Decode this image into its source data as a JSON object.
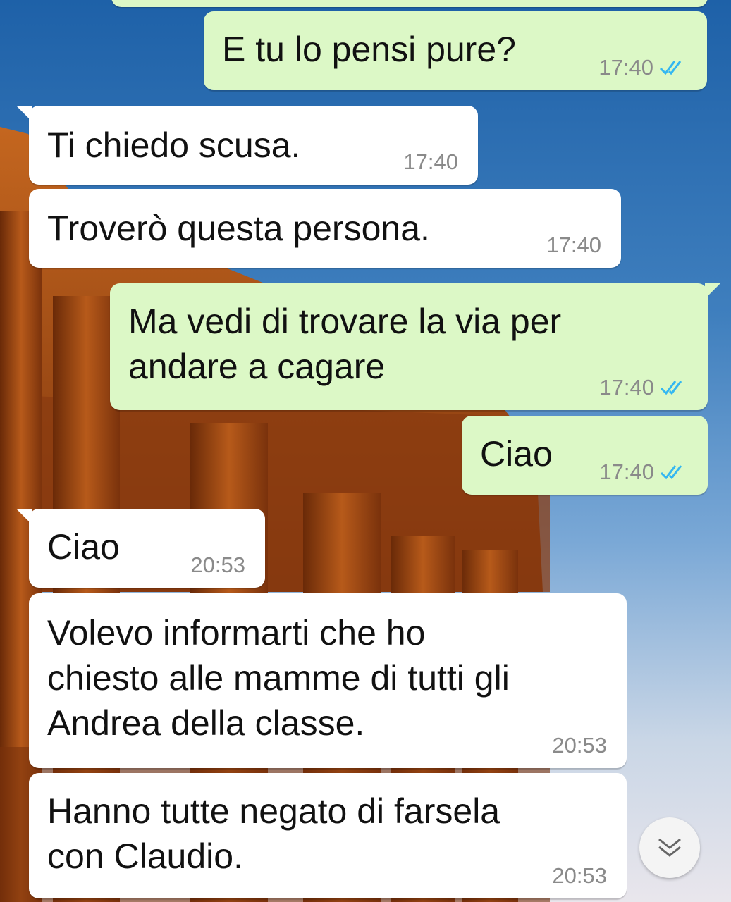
{
  "messages": [
    {
      "text": "",
      "time": "",
      "direction": "out"
    },
    {
      "text": "E tu lo pensi pure?",
      "time": "17:40",
      "direction": "out",
      "status": "read"
    },
    {
      "text": "Ti chiedo scusa.",
      "time": "17:40",
      "direction": "in"
    },
    {
      "text": "Troverò questa persona.",
      "time": "17:40",
      "direction": "in"
    },
    {
      "text": "Ma vedi di trovare la via per\nandare a cagare",
      "time": "17:40",
      "direction": "out",
      "status": "read"
    },
    {
      "text": "Ciao",
      "time": "17:40",
      "direction": "out",
      "status": "read"
    },
    {
      "text": "Ciao",
      "time": "20:53",
      "direction": "in"
    },
    {
      "text": "Volevo informarti che ho\nchiesto alle mamme di tutti gli\nAndrea della classe.",
      "time": "20:53",
      "direction": "in"
    },
    {
      "text": "Hanno tutte negato di farsela\ncon Claudio.",
      "time": "20:53",
      "direction": "in"
    }
  ],
  "scroll_button": {
    "icon": "chevron-double-down-icon"
  },
  "colors": {
    "outgoing_bubble": "#dcf8c6",
    "incoming_bubble": "#ffffff",
    "read_ticks": "#34b7f1",
    "timestamp": "#8a8a8a"
  }
}
